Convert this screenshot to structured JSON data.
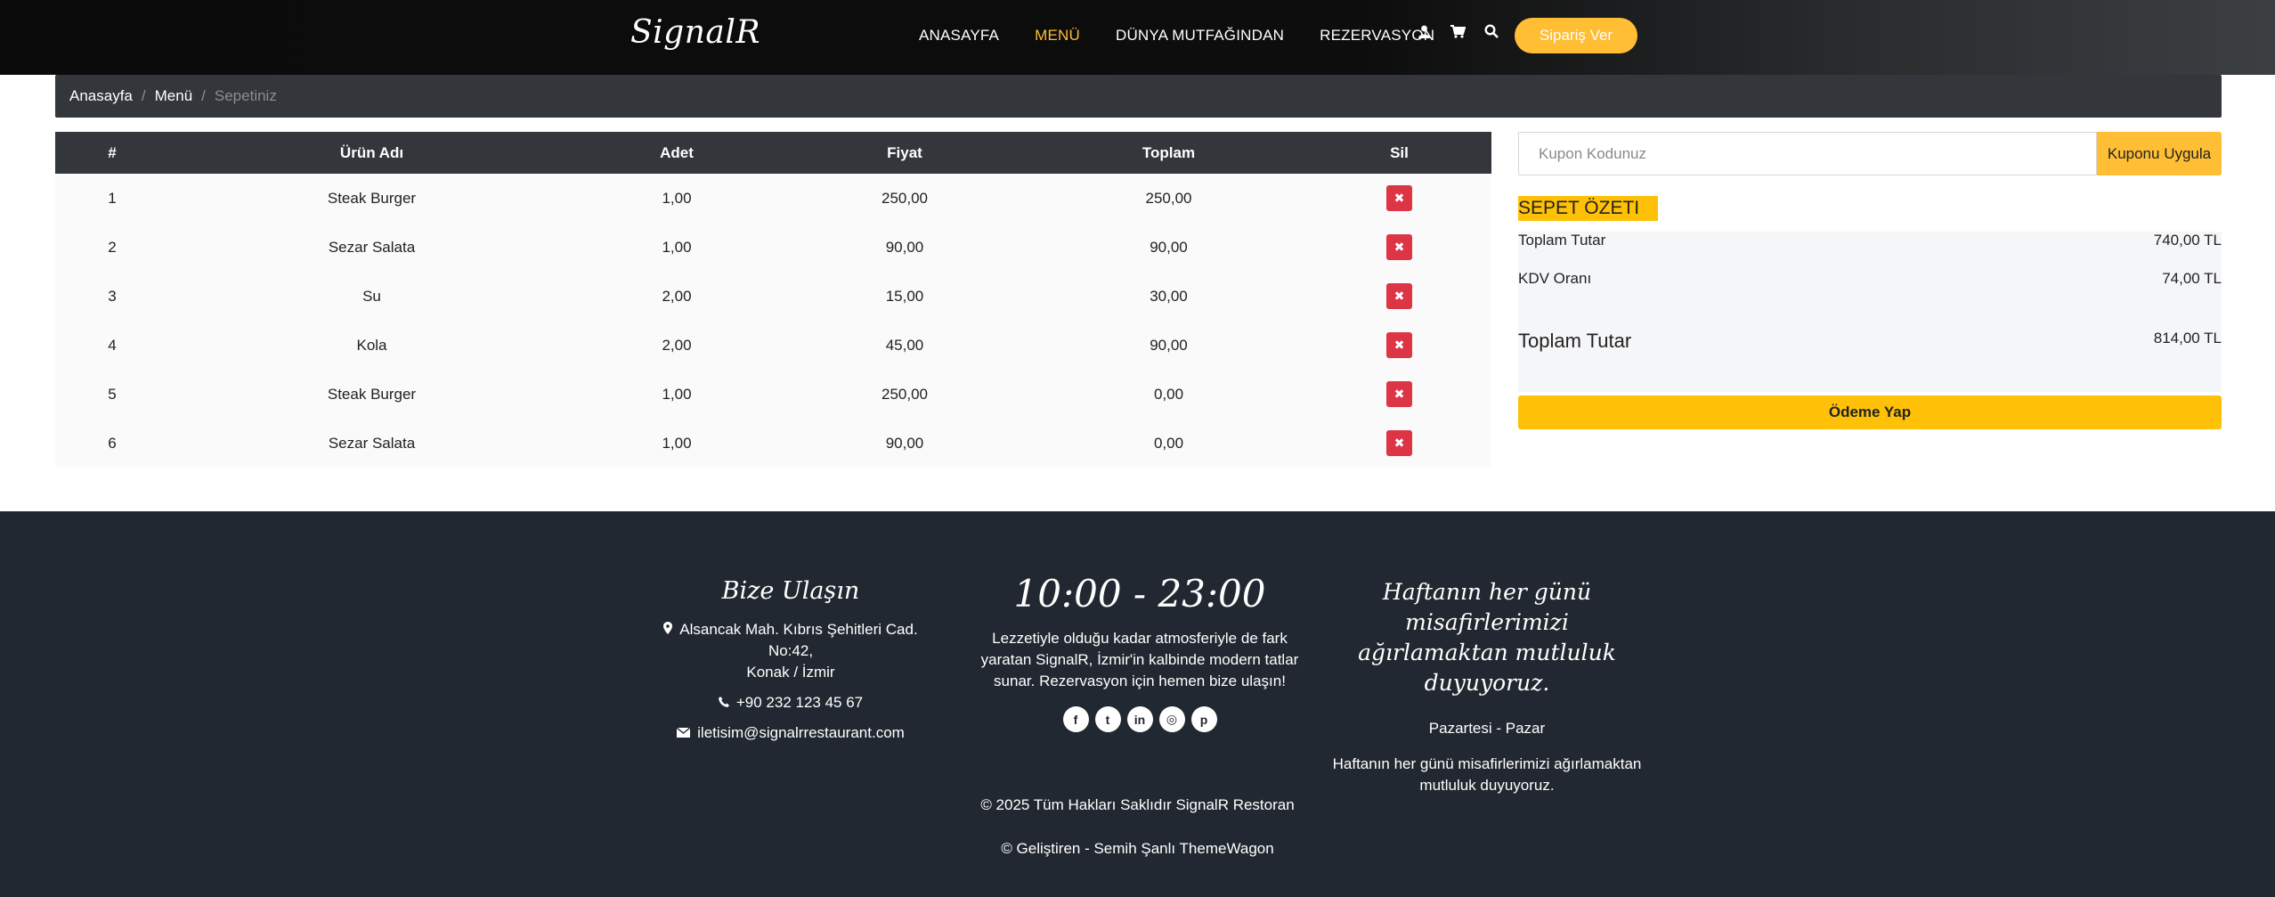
{
  "header": {
    "logo": "SignalR",
    "nav": [
      {
        "label": "ANASAYFA",
        "active": false
      },
      {
        "label": "MENÜ",
        "active": true
      },
      {
        "label": "DÜNYA MUTFAĞINDAN",
        "active": false
      },
      {
        "label": "REZERVASYON",
        "active": false
      }
    ],
    "icons": [
      "user-icon",
      "cart-icon",
      "search-icon"
    ],
    "order_button": "Sipariş Ver"
  },
  "breadcrumb": {
    "items": [
      "Anasayfa",
      "Menü"
    ],
    "current": "Sepetiniz"
  },
  "cart": {
    "columns": [
      "#",
      "Ürün Adı",
      "Adet",
      "Fiyat",
      "Toplam",
      "Sil"
    ],
    "rows": [
      {
        "no": "1",
        "name": "Steak Burger",
        "qty": "1,00",
        "price": "250,00",
        "total": "250,00"
      },
      {
        "no": "2",
        "name": "Sezar Salata",
        "qty": "1,00",
        "price": "90,00",
        "total": "90,00"
      },
      {
        "no": "3",
        "name": "Su",
        "qty": "2,00",
        "price": "15,00",
        "total": "30,00"
      },
      {
        "no": "4",
        "name": "Kola",
        "qty": "2,00",
        "price": "45,00",
        "total": "90,00"
      },
      {
        "no": "5",
        "name": "Steak Burger",
        "qty": "1,00",
        "price": "250,00",
        "total": "0,00"
      },
      {
        "no": "6",
        "name": "Sezar Salata",
        "qty": "1,00",
        "price": "90,00",
        "total": "0,00"
      }
    ],
    "delete_glyph": "✖"
  },
  "coupon": {
    "placeholder": "Kupon Kodunuz",
    "button": "Kuponu Uygula"
  },
  "summary": {
    "title": "SEPET ÖZETI",
    "subtotal_label": "Toplam Tutar",
    "subtotal_value": "740,00 TL",
    "tax_label": "KDV Oranı",
    "tax_value": "74,00 TL",
    "total_label": "Toplam Tutar",
    "total_value": "814,00 TL",
    "pay_button": "Ödeme Yap"
  },
  "footer": {
    "contact_title": "Bize Ulaşın",
    "address_line1": "Alsancak Mah. Kıbrıs Şehitleri Cad. No:42,",
    "address_line2": "Konak / İzmir",
    "phone": "+90 232 123 45 67",
    "email": "iletisim@signalrrestaurant.com",
    "hours_title": "10:00 - 23:00",
    "hours_desc_1": "Lezzetiyle olduğu kadar atmosferiyle de fark",
    "hours_desc_2": "yaratan SignalR, İzmir'in kalbinde modern tatlar",
    "hours_desc_3": "sunar. Rezervasyon için hemen bize ulaşın!",
    "social": [
      "facebook-icon",
      "twitter-icon",
      "linkedin-icon",
      "instagram-icon",
      "pinterest-icon"
    ],
    "welcome_title_1": "Haftanın her günü misafirlerimizi",
    "welcome_title_2": "ağırlamaktan mutluluk duyuyoruz.",
    "days": "Pazartesi - Pazar",
    "welcome_desc_1": "Haftanın her günü misafirlerimizi ağırlamaktan",
    "welcome_desc_2": "mutluluk duyuyoruz.",
    "copyright": "© 2025 Tüm Hakları Saklıdır SignalR Restoran",
    "developer": "© Geliştiren - Semih Şanlı ThemeWagon"
  },
  "colors": {
    "accent": "#ffbe33",
    "header_bg": "#0d0d0d",
    "table_header": "#33363b",
    "delete": "#dc3545",
    "footer_bg": "#222831"
  }
}
